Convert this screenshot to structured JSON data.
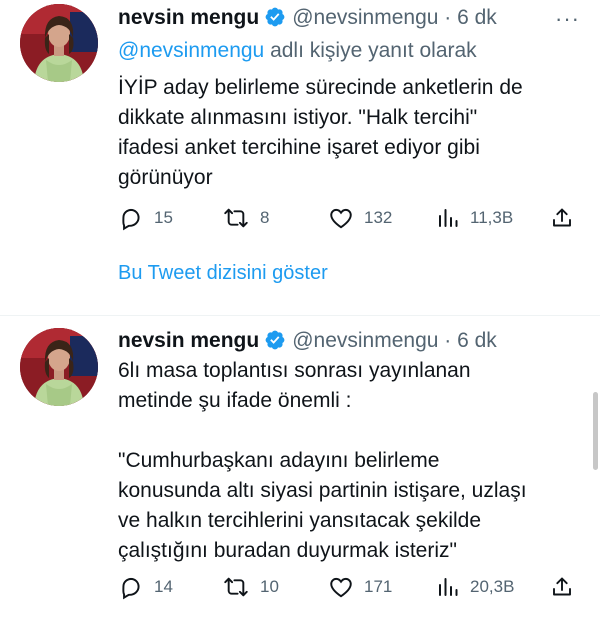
{
  "tweets": [
    {
      "name": "nevsin mengu",
      "handle": "@nevsinmengu",
      "time": "· 6 dk",
      "reply_prefix": "@nevsinmengu",
      "reply_suffix": " adlı kişiye yanıt olarak",
      "text": "İYİP aday belirleme sürecinde anketlerin de\ndikkate alınmasını istiyor. \"Halk tercihi\"\nifadesi anket tercihine işaret ediyor gibi\ngörünüyor",
      "replies": "15",
      "retweets": "8",
      "likes": "132",
      "views": "11,3B",
      "thread_link": "Bu Tweet dizisini göster"
    },
    {
      "name": "nevsin mengu",
      "handle": "@nevsinmengu",
      "time": "· 6 dk",
      "text": "6lı masa toplantısı sonrası yayınlanan\nmetinde şu ifade önemli :\n\n\"Cumhurbaşkanı adayını belirleme\nkonusunda altı siyasi partinin istişare, uzlaşı\nve halkın tercihlerini yansıtacak şekilde\nçalıştığını buradan duyurmak isteriz\"",
      "replies": "14",
      "retweets": "10",
      "likes": "171",
      "views": "20,3B"
    }
  ],
  "more_label": "···",
  "colors": {
    "accent": "#1d9bf0",
    "secondary": "#536471",
    "text": "#0f1419"
  }
}
